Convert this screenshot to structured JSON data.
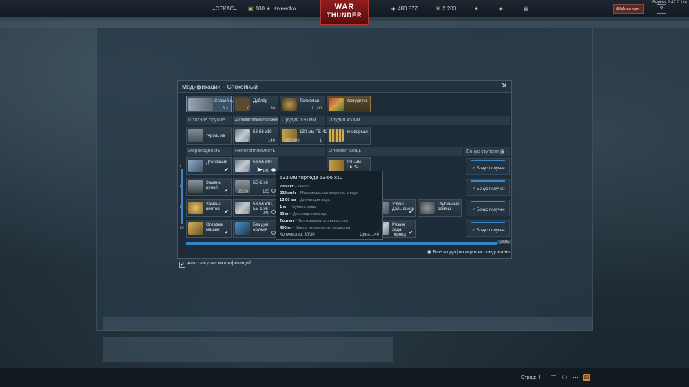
{
  "topbar": {
    "clan": "=СЕКАС=",
    "level": "100",
    "username": "Kweedko",
    "silver": "480 877",
    "gold": "2 203",
    "shop": "Магазин",
    "help": "?",
    "version": "Версия 2.47.0.114"
  },
  "logo": {
    "line1": "WAR",
    "line2": "THUNDER"
  },
  "modal": {
    "title": "Модификации – Спокойный",
    "cards": [
      {
        "name": "Спокойный",
        "price": "5.3"
      },
      {
        "name": "Дублёр",
        "count": "0",
        "price": "30"
      },
      {
        "name": "Талисман",
        "price": "1 100"
      },
      {
        "name": "Камуфляж"
      }
    ],
    "weapon_headers": [
      "Штатное оружие",
      "Дополнительное оружие",
      "Орудия 130 мм",
      "Орудия 45 мм"
    ],
    "weapons": [
      {
        "name": "турель x6"
      },
      {
        "name": "53-56 x10",
        "count": "30/30",
        "price": "140"
      },
      {
        "name": "130-мм ПБ-42",
        "count": "300/300",
        "price": "1"
      },
      {
        "name": "Универсал"
      }
    ],
    "mod_headers": [
      "Мореходность",
      "Непотопляемость",
      "Огневая мощь",
      "Бонус ступени"
    ],
    "tiers": [
      "I",
      "II",
      "III",
      "IV"
    ],
    "seaworthiness": [
      {
        "name": "Докование"
      },
      {
        "name": "Замена рулей"
      },
      {
        "name": "Замена винтов"
      },
      {
        "name": "Огладка машин"
      }
    ],
    "survivability": [
      {
        "name": "53-56 x10",
        "count": "30/30",
        "price": "140"
      },
      {
        "name": "ББ-1 x6",
        "count": "30/30",
        "price": "105"
      },
      {
        "name": "53-56 x10, ББ-1 x6",
        "count": "30/30",
        "price": "240"
      },
      {
        "name": "Без доп. оружия"
      }
    ],
    "firepower": [
      {
        "name": "130-мм ПБ-42"
      },
      {
        "name": "Улучш. дальномер"
      },
      {
        "name": "Глубинные бомбы"
      },
      {
        "name": "Режим хода торпед"
      }
    ],
    "bonus": [
      "Бонус получен",
      "Бонус получен",
      "Бонус получен",
      "Бонус получен"
    ],
    "progress_pct": "100%",
    "all_researched": "Все модификации исследованы",
    "autobuy": "Автозакупка модификаций"
  },
  "tooltip": {
    "title": "533-мм торпеда 53-56 x10",
    "rows": [
      {
        "v": "2000 кг",
        "k": "Масса"
      },
      {
        "v": "222 км/ч",
        "k": "Максимальная скорость в воде"
      },
      {
        "v": "13.00 км",
        "k": "Дистанция хода"
      },
      {
        "v": "1 м",
        "k": "Глубина хода"
      },
      {
        "v": "50 м",
        "k": "Дистанция взвода"
      },
      {
        "v": "Тротил",
        "k": "Тип взрывчатого вещества"
      },
      {
        "v": "400 кг",
        "k": "Масса взрывчатого вещества"
      }
    ],
    "quantity": "Количество: 30/30",
    "price": "Цена: 140"
  },
  "bottombar": {
    "squad": "Отряд:"
  },
  "colors": {
    "accent": "#3f86c6",
    "modal_bg": "#1e2c38",
    "brand_red": "#8f1e1e"
  }
}
